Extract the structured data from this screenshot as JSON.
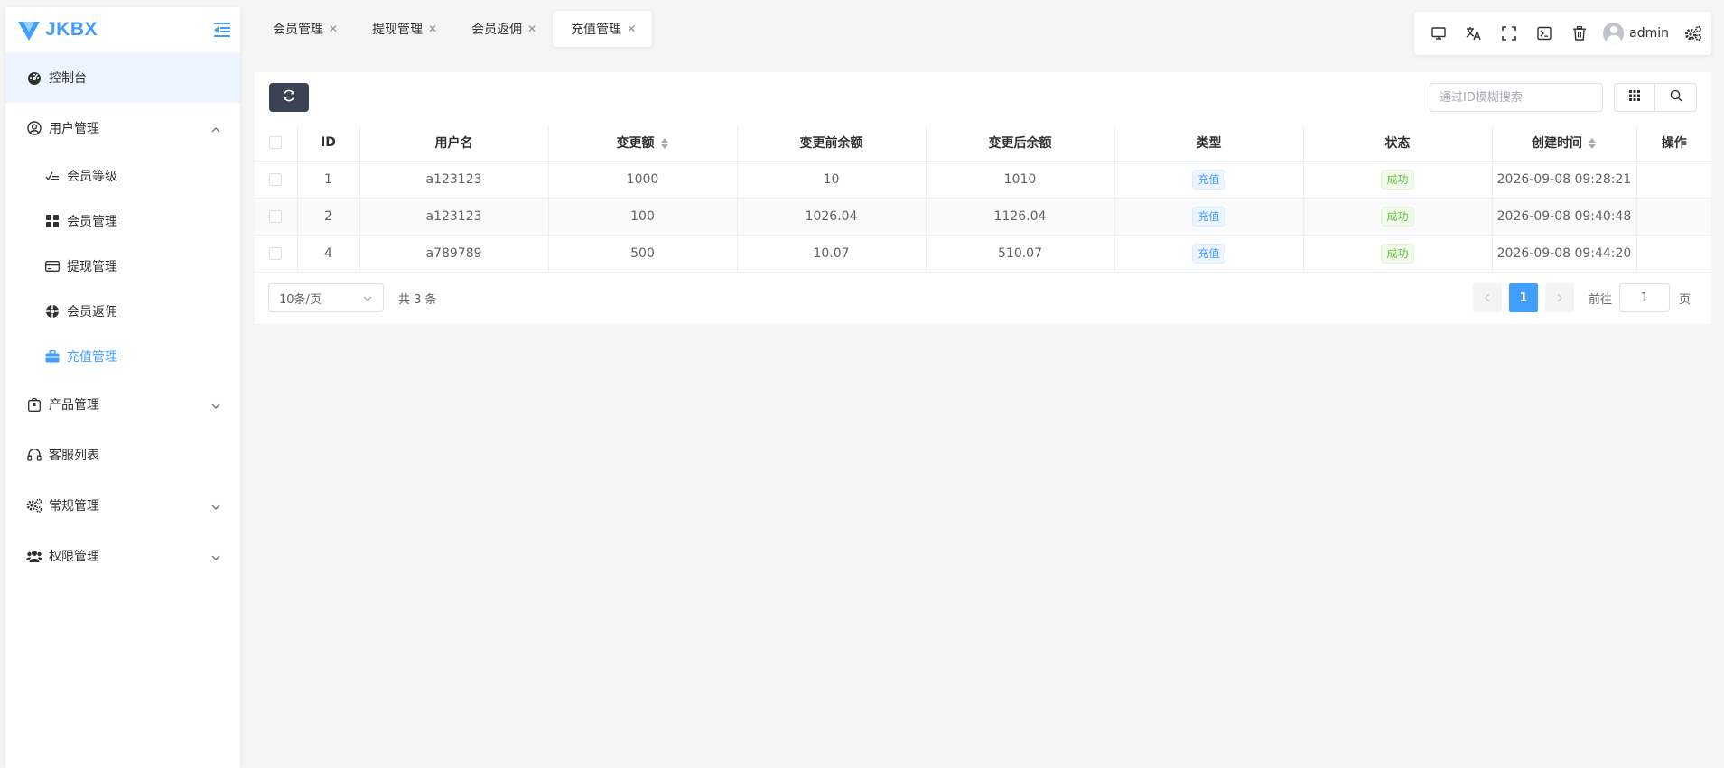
{
  "app": {
    "logo_text": "JKBX"
  },
  "sidebar": {
    "items": [
      {
        "label": "控制台",
        "icon": "dashboard-icon"
      },
      {
        "label": "用户管理",
        "icon": "user-circle-icon",
        "expanded": true,
        "children": [
          {
            "label": "会员等级",
            "icon": "level-icon"
          },
          {
            "label": "会员管理",
            "icon": "grid-icon"
          },
          {
            "label": "提现管理",
            "icon": "credit-card-icon"
          },
          {
            "label": "会员返佣",
            "icon": "commission-icon"
          },
          {
            "label": "充值管理",
            "icon": "briefcase-icon",
            "selected": true
          }
        ]
      },
      {
        "label": "产品管理",
        "icon": "product-icon"
      },
      {
        "label": "客服列表",
        "icon": "headset-icon"
      },
      {
        "label": "常规管理",
        "icon": "cogs-icon"
      },
      {
        "label": "权限管理",
        "icon": "users-icon"
      }
    ]
  },
  "tabs": [
    {
      "label": "会员管理"
    },
    {
      "label": "提现管理"
    },
    {
      "label": "会员返佣"
    },
    {
      "label": "充值管理",
      "active": true
    }
  ],
  "header": {
    "username": "admin"
  },
  "search": {
    "placeholder": "通过ID模糊搜索"
  },
  "table": {
    "columns": [
      "ID",
      "用户名",
      "变更额",
      "变更前余额",
      "变更后余额",
      "类型",
      "状态",
      "创建时间",
      "操作"
    ],
    "rows": [
      {
        "id": "1",
        "username": "a123123",
        "amount": "1000",
        "before": "10",
        "after": "1010",
        "type": "充值",
        "status": "成功",
        "created": "2026-09-08 09:28:21"
      },
      {
        "id": "2",
        "username": "a123123",
        "amount": "100",
        "before": "1026.04",
        "after": "1126.04",
        "type": "充值",
        "status": "成功",
        "created": "2026-09-08 09:40:48"
      },
      {
        "id": "4",
        "username": "a789789",
        "amount": "500",
        "before": "10.07",
        "after": "510.07",
        "type": "充值",
        "status": "成功",
        "created": "2026-09-08 09:44:20"
      }
    ]
  },
  "pagination": {
    "page_size": "10条/页",
    "total": "共 3 条",
    "current": "1",
    "goto_label": "前往",
    "goto_value": "1",
    "unit": "页"
  },
  "colors": {
    "accent": "#409eff",
    "dark_button": "#3a4253",
    "success": "#67c23a"
  }
}
